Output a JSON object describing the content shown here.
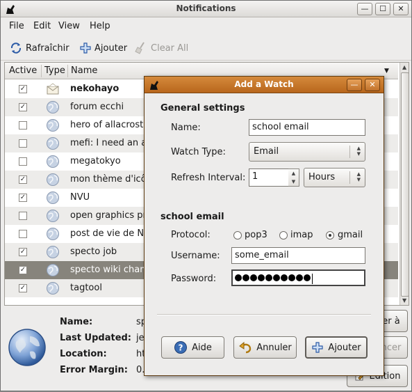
{
  "window": {
    "title": "Notifications"
  },
  "menubar": {
    "items": [
      "File",
      "Edit",
      "View",
      "Help"
    ]
  },
  "toolbar": {
    "refresh": "Rafraîchir",
    "add": "Ajouter",
    "clear_all": "Clear All"
  },
  "list": {
    "columns": [
      "Active",
      "Type",
      "Name"
    ],
    "rows": [
      {
        "active": true,
        "name": "nekohayo",
        "type_icon": "mail-icon"
      },
      {
        "active": true,
        "name": "forum ecchi",
        "type_icon": "web-icon"
      },
      {
        "active": false,
        "name": "hero of allacrost",
        "type_icon": "web-icon"
      },
      {
        "active": false,
        "name": "mefi: I need an a",
        "type_icon": "web-icon"
      },
      {
        "active": false,
        "name": "megatokyo",
        "type_icon": "web-icon"
      },
      {
        "active": true,
        "name": "mon thème d'icô",
        "type_icon": "web-icon"
      },
      {
        "active": true,
        "name": "NVU",
        "type_icon": "web-icon"
      },
      {
        "active": false,
        "name": "open graphics pr",
        "type_icon": "web-icon"
      },
      {
        "active": false,
        "name": "post de vie de NV",
        "type_icon": "web-icon"
      },
      {
        "active": true,
        "name": "specto job",
        "type_icon": "web-icon"
      },
      {
        "active": true,
        "name": "specto wiki chan",
        "type_icon": "web-icon"
      },
      {
        "active": true,
        "name": "tagtool",
        "type_icon": "web-icon"
      }
    ]
  },
  "details": {
    "name_label": "Name:",
    "name_value": "sp",
    "last_updated_label": "Last Updated:",
    "last_updated_value": "je",
    "location_label": "Location:",
    "location_value": "ht",
    "error_margin_label": "Error Margin:",
    "error_margin_value": "0.",
    "btn_right_top": "er à",
    "btn_right_mid": "ncer",
    "btn_edition": "Édition"
  },
  "dialog": {
    "title": "Add a Watch",
    "general_settings": "General settings",
    "name_label": "Name:",
    "name_value": "school email",
    "watch_type_label": "Watch Type:",
    "watch_type_value": "Email",
    "refresh_label": "Refresh Interval:",
    "refresh_value": "1",
    "refresh_unit": "Hours",
    "section2": "school email",
    "protocol_label": "Protocol:",
    "protocols": [
      "pop3",
      "imap",
      "gmail"
    ],
    "protocol_selected": "gmail",
    "username_label": "Username:",
    "username_value": "some_email",
    "password_label": "Password:",
    "buttons": {
      "help": "Aide",
      "cancel": "Annuler",
      "add": "Ajouter"
    }
  },
  "colors": {
    "dialog_title": "#c87a2f",
    "selected_row": "#87847c"
  }
}
